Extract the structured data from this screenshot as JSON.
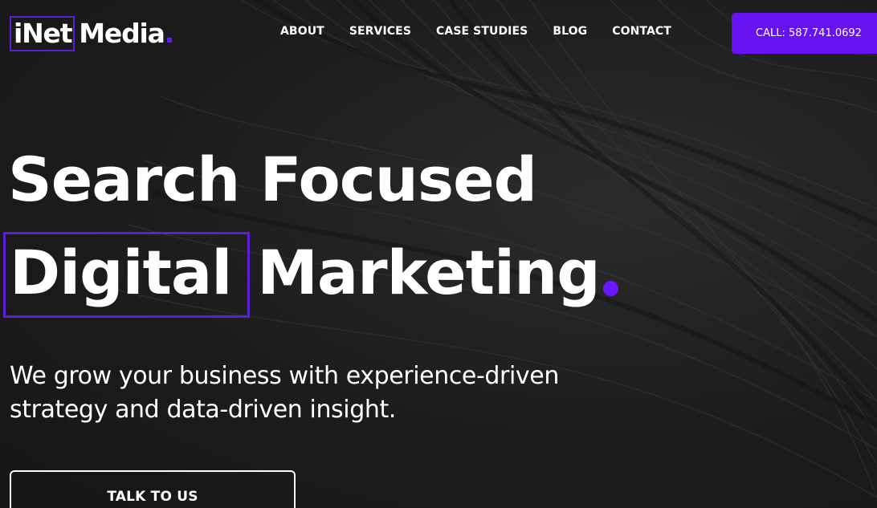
{
  "brand": {
    "logo_part1": "iNet",
    "logo_part2": "Media",
    "logo_dot": ".",
    "accent_color": "#6712f0",
    "box_color": "#5b1fd6"
  },
  "nav": {
    "items": [
      {
        "label": "ABOUT"
      },
      {
        "label": "SERVICES"
      },
      {
        "label": "CASE STUDIES"
      },
      {
        "label": "BLOG"
      },
      {
        "label": "CONTACT"
      }
    ],
    "call_label": "CALL: 587.741.0692"
  },
  "hero": {
    "line1": "Search Focused",
    "highlight_word": "Digital",
    "line2_rest": "Marketing",
    "subtext_line1": "We grow your business with experience-driven",
    "subtext_line2": "strategy and data-driven insight.",
    "cta_label": "TALK TO US",
    "background": "dark abstract wave lines"
  }
}
